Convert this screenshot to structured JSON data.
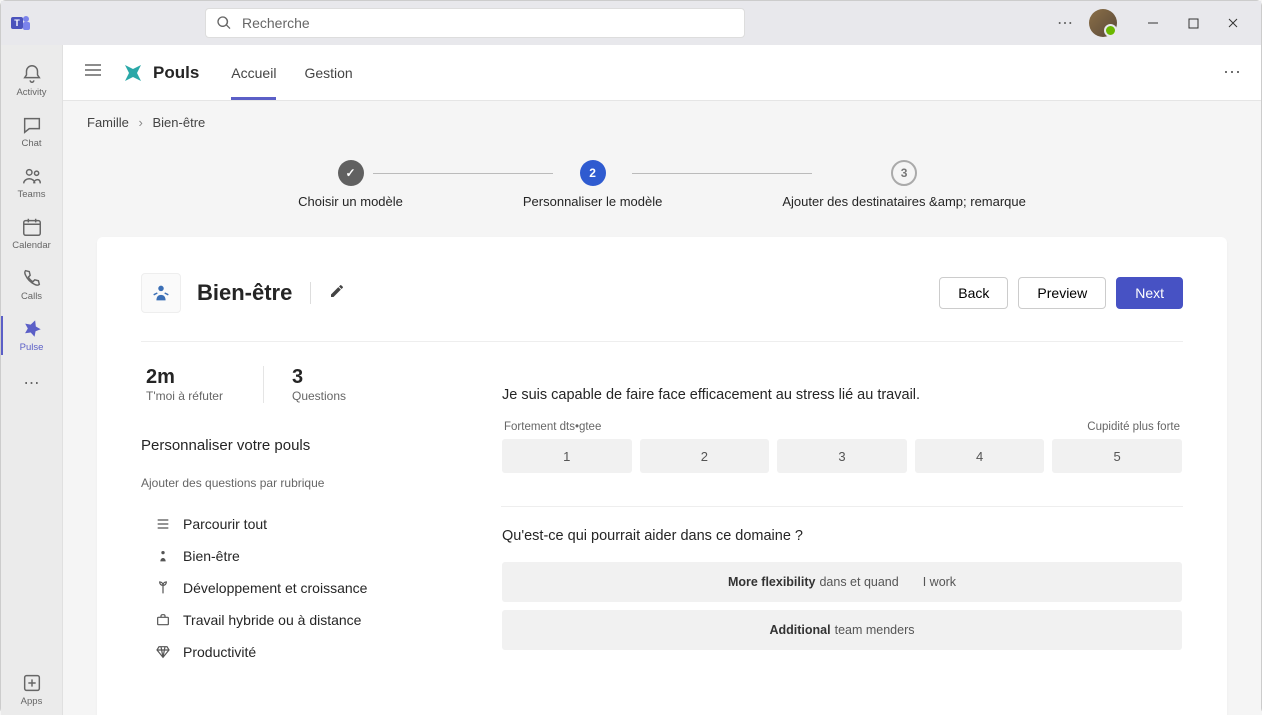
{
  "titlebar": {
    "search_placeholder": "Recherche"
  },
  "rail": {
    "activity": "Activity",
    "chat": "Chat",
    "teams": "Teams",
    "calendar": "Calendar",
    "calls": "Calls",
    "pulse": "Pulse",
    "apps": "Apps"
  },
  "app": {
    "name": "Pouls",
    "tabs": {
      "home": "Accueil",
      "gestion": "Gestion"
    }
  },
  "breadcrumb": {
    "root": "Famille",
    "current": "Bien-être"
  },
  "stepper": {
    "step1": "Choisir un modèle",
    "step2": "Personnaliser le modèle",
    "step3": "Ajouter des destinataires &amp; remarque",
    "step2_num": "2",
    "step3_num": "3"
  },
  "card": {
    "title": "Bien-être",
    "buttons": {
      "back": "Back",
      "preview": "Preview",
      "next": "Next"
    },
    "stats": {
      "time_val": "2m",
      "time_lbl": "T'moi à réfuter",
      "q_val": "3",
      "q_lbl": "Questions"
    }
  },
  "sidebar": {
    "title": "Personnaliser votre pouls",
    "sub": "Ajouter des questions par rubrique",
    "topics": {
      "browse": "Parcourir tout",
      "wellbeing": "Bien-être",
      "dev": "Développement et croissance",
      "hybrid": "Travail hybride ou à distance",
      "prod": "Productivité"
    }
  },
  "questions": {
    "q1_text": "Je suis capable de faire face efficacement au stress lié au travail.",
    "scale_left": "Fortement dts•gtee",
    "scale_right": "Cupidité plus forte",
    "scale": {
      "1": "1",
      "2": "2",
      "3": "3",
      "4": "4",
      "5": "5"
    },
    "q2_text": "Qu'est-ce qui pourrait aider dans ce domaine ?",
    "opt1_bold": "More flexibility",
    "opt1_mid": "dans et quand",
    "opt1_end": "I work",
    "opt2_bold": "Additional",
    "opt2_end": "team menders"
  }
}
